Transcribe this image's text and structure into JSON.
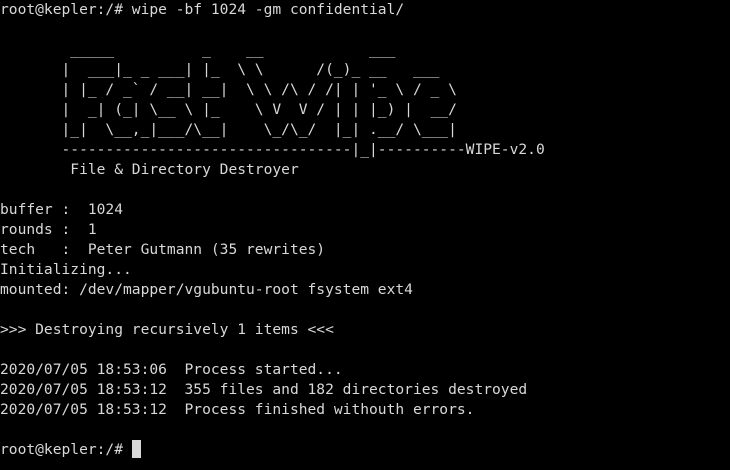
{
  "terminal": {
    "prompt": "root@kepler:/# ",
    "command": "wipe -bf 1024 -gm confidential/",
    "banner": [
      "        _____          _    __            ___",
      "       |  ___|_ _ ___| |_  \\ \\      /(_)_ __   ___",
      "       | |_ / _` / __| __|  \\ \\ /\\ / /| | '_ \\ / _ \\",
      "       |  _| (_| \\__ \\ |_    \\ V  V / | | |_) |  __/",
      "       |_|  \\__,_|___/\\__|    \\_/\\_/  |_| .__/ \\___|",
      "       ---------------------------------|_|----------WIPE-v2.0"
    ],
    "subtitle": "        File & Directory Destroyer",
    "info": [
      "buffer :  1024",
      "rounds :  1",
      "tech   :  Peter Gutmann (35 rewrites)",
      "Initializing...",
      "mounted: /dev/mapper/vgubuntu-root fsystem ext4"
    ],
    "destroying": ">>> Destroying recursively 1 items <<<",
    "log": [
      "2020/07/05 18:53:06  Process started...",
      "2020/07/05 18:53:12  355 files and 182 directories destroyed",
      "2020/07/05 18:53:12  Process finished withouth errors."
    ],
    "final_prompt": "root@kepler:/# ",
    "colors": {
      "background": "#000000",
      "foreground": "#d8d8d8"
    }
  }
}
